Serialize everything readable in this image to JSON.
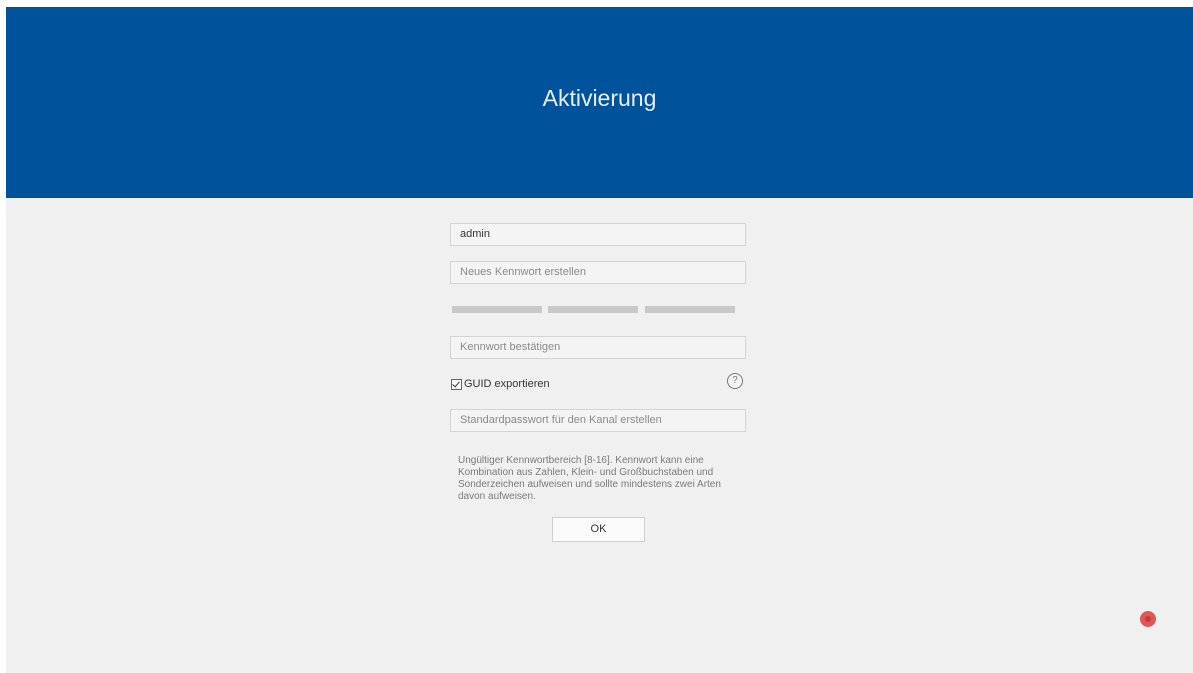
{
  "header": {
    "title": "Aktivierung"
  },
  "form": {
    "username_value": "admin",
    "new_password_placeholder": "Neues Kennwort erstellen",
    "confirm_password_placeholder": "Kennwort bestätigen",
    "guid_export_label": "GUID exportieren",
    "guid_export_checked": true,
    "channel_password_placeholder": "Standardpasswort für den Kanal erstellen",
    "hint_text": "Ungültiger Kennwortbereich [8-16]. Kennwort kann eine Kombination aus Zahlen, Klein- und Großbuchstaben und Sonderzeichen aufweisen und sollte mindestens zwei Arten davon aufweisen.",
    "ok_label": "OK",
    "help_symbol": "?"
  },
  "colors": {
    "header_bg": "#00529b",
    "body_bg": "#f0f0f0",
    "strength_bar": "#c8c8c8",
    "record_indicator": "#e05757"
  },
  "icons": {
    "help": "question-circle-icon",
    "record": "record-indicator-icon"
  }
}
